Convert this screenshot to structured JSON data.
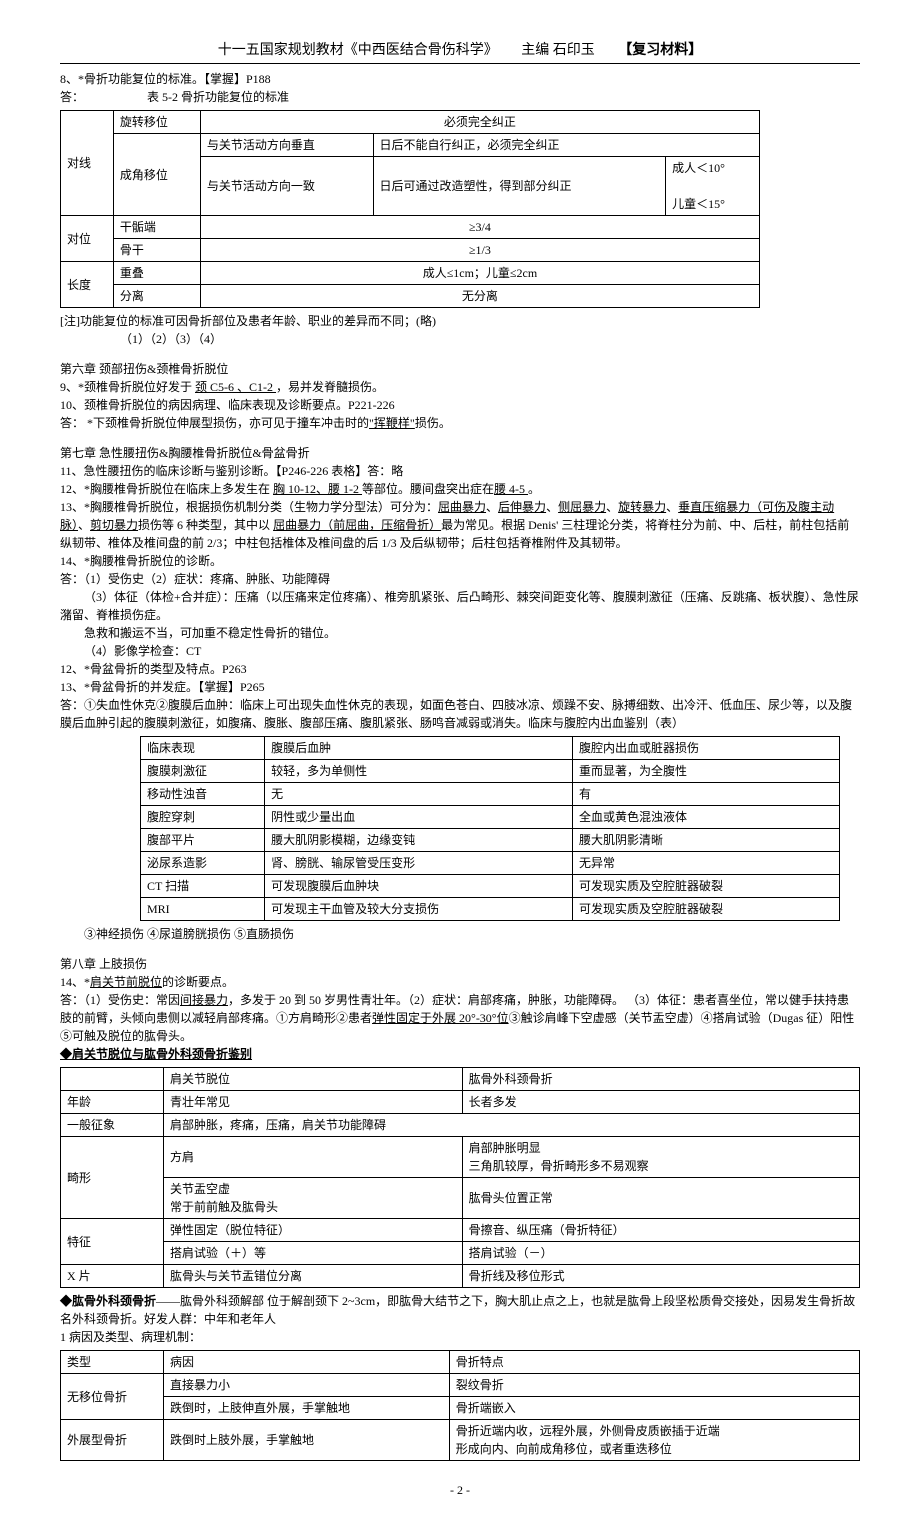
{
  "header": {
    "title": "十一五国家规划教材《中西医结合骨伤科学》",
    "editor": "主编 石印玉",
    "material": "【复习材料】"
  },
  "q8": {
    "title": "8、*骨折功能复位的标准。【掌握】P188",
    "ans": "答：",
    "tableTitle": "表 5-2  骨折功能复位的标准"
  },
  "t52": {
    "r1c1": "对线",
    "r1c2": "旋转移位",
    "r1c3": "必须完全纠正",
    "r2c2": "成角移位",
    "r2c3a": "与关节活动方向垂直",
    "r2c3b": "日后不能自行纠正，必须完全纠正",
    "r3c3a": "与关节活动方向一致",
    "r3c3b": "日后可通过改造塑性，得到部分纠正",
    "r3c4": "成人＜10°",
    "r3c5": "儿童＜15°",
    "r4c1": "对位",
    "r4c2": "干骺端",
    "r4c3": "≥3/4",
    "r5c2": "骨干",
    "r5c3": "≥1/3",
    "r6c1": "长度",
    "r6c2": "重叠",
    "r6c3": "成人≤1cm；儿童≤2cm",
    "r7c2": "分离",
    "r7c3": "无分离"
  },
  "t52note": "[注]功能复位的标准可因骨折部位及患者年龄、职业的差异而不同；(略)",
  "t52note2": "（1）（2）（3）（4）",
  "ch6": {
    "title": "第六章  颈部扭伤&颈椎骨折脱位",
    "q9": "9、*颈椎骨折脱位好发于 ",
    "q9u": "颈 C5-6 、C1-2 ",
    "q9b": "，易并发脊髓损伤。",
    "q10": "10、颈椎骨折脱位的病因病理、临床表现及诊断要点。P221-226",
    "q10a": "答：  *下颈椎骨折脱位伸展型损伤，亦可见于撞车冲击时的",
    "q10u": "\"挥鞭样\"",
    "q10b": "损伤。"
  },
  "ch7": {
    "title": "第七章  急性腰扭伤&胸腰椎骨折脱位&骨盆骨折",
    "q11": "11、急性腰扭伤的临床诊断与鉴别诊断。【P246-226 表格】答：略",
    "q12a": "12、*胸腰椎骨折脱位在临床上多发生在 ",
    "q12u1": "胸 10-12、腰 1-2 ",
    "q12b": "等部位。腰间盘突出症在",
    "q12u2": "腰 4-5 ",
    "q12c": "。",
    "q13a": "13、*胸腰椎骨折脱位，根据损伤机制分类（生物力学分型法）可分为：",
    "q13u1": "屈曲暴力",
    "q13s1": "、",
    "q13u2": "后伸暴力",
    "q13s2": "、",
    "q13u3": "侧屈暴力",
    "q13s3": "、",
    "q13u4": "旋转暴力",
    "q13s4": "、",
    "q13u5": "垂直压缩暴力（可伤及腹主动脉）",
    "q13s5": "、",
    "q13u6": "剪切暴力",
    "q13b": "损伤等 6 种类型，其中以 ",
    "q13u7": "屈曲暴力（前屈曲，压缩骨折）",
    "q13c": "最为常见。根据 Denis' 三柱理论分类，将脊柱分为前、中、后柱，前柱包括前纵韧带、椎体及椎间盘的前 2/3；中柱包括椎体及椎间盘的后 1/3 及后纵韧带；后柱包括脊椎附件及其韧带。",
    "q14": "14、*胸腰椎骨折脱位的诊断。",
    "q14a": "答：（1）受伤史（2）症状：疼痛、肿胀、功能障碍",
    "q14b": "（3）体征（体检+合并症）：压痛（以压痛来定位疼痛）、椎旁肌紧张、后凸畸形、棘突间距变化等、腹膜刺激征（压痛、反跳痛、板状腹）、急性尿潴留、脊椎损伤症。",
    "q14c": "急救和搬运不当，可加重不稳定性骨折的错位。",
    "q14d": "（4）影像学检查：CT",
    "q12x": "12、*骨盆骨折的类型及特点。P263",
    "q13x": "13、*骨盆骨折的并发症。【掌握】P265",
    "q13xa": "答：①失血性休克②腹膜后血肿：临床上可出现失血性休克的表现，如面色苍白、四肢冰凉、烦躁不安、脉搏细数、出冷汗、低血压、尿少等，以及腹膜后血肿引起的腹膜刺激征，如腹痛、腹胀、腹部压痛、腹肌紧张、肠鸣音减弱或消失。临床与腹腔内出血鉴别（表）"
  },
  "t2": {
    "h1": "临床表现",
    "h2": "腹膜后血肿",
    "h3": "腹腔内出血或脏器损伤",
    "r1c1": "腹膜刺激征",
    "r1c2": "较轻，多为单侧性",
    "r1c3": "重而显著，为全腹性",
    "r2c1": "移动性浊音",
    "r2c2": "无",
    "r2c3": "有",
    "r3c1": "腹腔穿刺",
    "r3c2": "阴性或少量出血",
    "r3c3": "全血或黄色混浊液体",
    "r4c1": "腹部平片",
    "r4c2": "腰大肌阴影模糊，边缘变钝",
    "r4c3": "腰大肌阴影清晰",
    "r5c1": "泌尿系造影",
    "r5c2": "肾、膀胱、输尿管受压变形",
    "r5c3": "无异常",
    "r6c1": "CT 扫描",
    "r6c2": "可发现腹膜后血肿块",
    "r6c3": "可发现实质及空腔脏器破裂",
    "r7c1": "MRI",
    "r7c2": "可发现主干血管及较大分支损伤",
    "r7c3": "可发现实质及空腔脏器破裂"
  },
  "t2foot": "③神经损伤      ④尿道膀胱损伤      ⑤直肠损伤",
  "ch8": {
    "title": "第八章  上肢损伤",
    "q14a": "14、*",
    "q14u": "肩关节前脱位",
    "q14b": "的诊断要点。",
    "ans": "答：（1）受伤史：常因",
    "ansu1": "间接暴力",
    "ans2": "，多发于 20 到 50 岁男性青壮年。（2）症状：肩部疼痛，肿胀，功能障碍。   （3）体征：患者喜坐位，常以健手扶持患肢的前臂，头倾向患侧以减轻肩部疼痛。①方肩畸形②患者",
    "ansu2": "弹性固定于外展 20°-30°位",
    "ans3": "③触诊肩峰下空虚感（关节盂空虚）④搭肩试验（Dugas 征）阳性⑤可触及脱位的肱骨头。",
    "diffTitle": "◆肩关节脱位与肱骨外科颈骨折鉴别"
  },
  "t3": {
    "h2": "肩关节脱位",
    "h3": "肱骨外科颈骨折",
    "r1c1": "年龄",
    "r1c2": "青壮年常见",
    "r1c3": "长者多发",
    "r2c1": "一般征象",
    "r2c2": "肩部肿胀，疼痛，压痛，肩关节功能障碍",
    "r3c1": "畸形",
    "r3c2": "方肩",
    "r3c3a": "肩部肿胀明显",
    "r3c3b": "三角肌较厚，骨折畸形多不易观察",
    "r4c2a": "关节盂空虚",
    "r4c2b": "常于前前触及肱骨头",
    "r4c3": "肱骨头位置正常",
    "r5c1": "特征",
    "r5c2a": "弹性固定（脱位特征）",
    "r5c2b": "搭肩试验（＋）等",
    "r5c3a": "骨擦音、纵压痛（骨折特征）",
    "r5c3b": "搭肩试验（－）",
    "r6c1": "X 片",
    "r6c2": "肱骨头与关节盂错位分离",
    "r6c3": "骨折线及移位形式"
  },
  "humerus": {
    "title": "◆肱骨外科颈骨折",
    "text": "——肱骨外科颈解部 位于解剖颈下 2~3cm，即肱骨大结节之下，胸大肌止点之上，也就是肱骨上段坚松质骨交接处，因易发生骨折故名外科颈骨折。好发人群：中年和老年人",
    "sub": "1 病因及类型、病理机制："
  },
  "t4": {
    "h1": "类型",
    "h2": "病因",
    "h3": "骨折特点",
    "r1c1": "无移位骨折",
    "r1c2a": "直接暴力小",
    "r1c2b": "跌倒时，上肢伸直外展，手掌触地",
    "r1c3a": "裂纹骨折",
    "r1c3b": "骨折端嵌入",
    "r2c1": "外展型骨折",
    "r2c2": "跌倒时上肢外展，手掌触地",
    "r2c3a": "骨折近端内收，远程外展，外侧骨皮质嵌插于近端",
    "r2c3b": "形成向内、向前成角移位，或者重迭移位"
  },
  "footer": "- 2 -"
}
